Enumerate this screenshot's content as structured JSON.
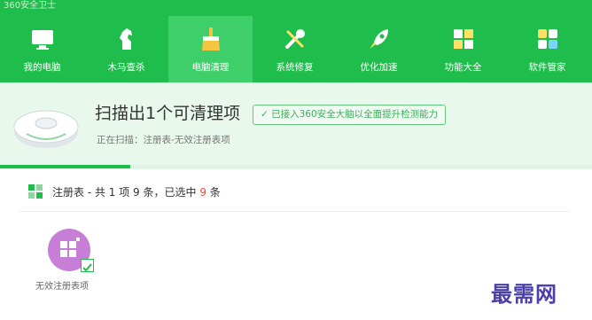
{
  "window": {
    "title": "360安全卫士"
  },
  "nav": {
    "items": [
      {
        "label": "我的电脑",
        "icon": "monitor-icon"
      },
      {
        "label": "木马查杀",
        "icon": "horse-icon"
      },
      {
        "label": "电脑清理",
        "icon": "broom-icon",
        "active": true
      },
      {
        "label": "系统修复",
        "icon": "wrench-icon"
      },
      {
        "label": "优化加速",
        "icon": "rocket-icon"
      },
      {
        "label": "功能大全",
        "icon": "grid-icon"
      },
      {
        "label": "软件管家",
        "icon": "apps-icon"
      }
    ]
  },
  "scan": {
    "title": "扫描出1个可清理项",
    "badge": "已接入360安全大脑以全面提升检测能力",
    "status": "正在扫描：注册表-无效注册表项",
    "progress": 0.22
  },
  "summary": {
    "prefix": "注册表 - 共 1 项 9 条，已选中 ",
    "selected_count": "9",
    "suffix": " 条"
  },
  "items": [
    {
      "label": "无效注册表项",
      "checked": true
    }
  ],
  "watermark": "最需网",
  "colors": {
    "accent": "#1fbe4c",
    "highlight": "#f04a2e",
    "tile": "#c77ed6"
  }
}
